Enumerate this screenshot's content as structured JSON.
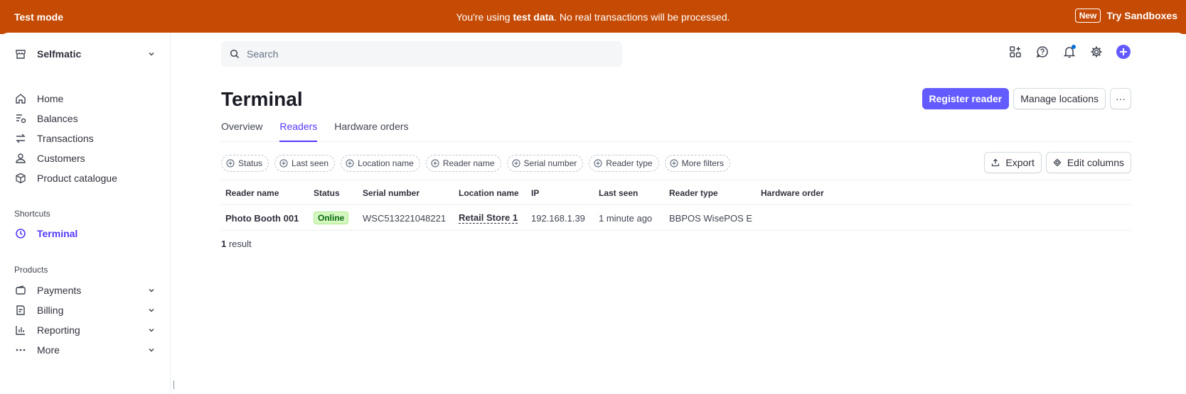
{
  "banner": {
    "left": "Test mode",
    "message_prefix": "You're using ",
    "message_bold": "test data",
    "message_suffix": ". No real transactions will be processed.",
    "badge": "New",
    "link": "Try Sandboxes"
  },
  "sidebar": {
    "account": "Selfmatic",
    "items": [
      {
        "label": "Home",
        "icon": "home-icon"
      },
      {
        "label": "Balances",
        "icon": "balances-icon"
      },
      {
        "label": "Transactions",
        "icon": "transactions-icon"
      },
      {
        "label": "Customers",
        "icon": "customers-icon"
      },
      {
        "label": "Product catalogue",
        "icon": "product-catalogue-icon"
      }
    ],
    "shortcuts_label": "Shortcuts",
    "shortcuts": [
      {
        "label": "Terminal",
        "icon": "clock-icon"
      }
    ],
    "products_label": "Products",
    "products": [
      {
        "label": "Payments",
        "icon": "wallet-icon"
      },
      {
        "label": "Billing",
        "icon": "billing-icon"
      },
      {
        "label": "Reporting",
        "icon": "reporting-icon"
      },
      {
        "label": "More",
        "icon": "more-dots-icon"
      }
    ]
  },
  "search": {
    "placeholder": "Search"
  },
  "page": {
    "title": "Terminal",
    "register_button": "Register reader",
    "manage_button": "Manage locations",
    "more_button": "···"
  },
  "tabs": [
    "Overview",
    "Readers",
    "Hardware orders"
  ],
  "active_tab": "Readers",
  "filters": [
    "Status",
    "Last seen",
    "Location name",
    "Reader name",
    "Serial number",
    "Reader type",
    "More filters"
  ],
  "table_actions": {
    "export": "Export",
    "edit_columns": "Edit columns"
  },
  "table": {
    "columns": [
      "Reader name",
      "Status",
      "Serial number",
      "Location name",
      "IP",
      "Last seen",
      "Reader type",
      "Hardware order"
    ],
    "rows": [
      {
        "reader_name": "Photo Booth 001",
        "status": "Online",
        "serial_number": "WSC513221048221",
        "location_name": "Retail Store 1",
        "ip": "192.168.1.39",
        "last_seen": "1 minute ago",
        "reader_type": "BBPOS WisePOS E",
        "hardware_order": ""
      }
    ]
  },
  "result": {
    "count": "1",
    "label": " result"
  },
  "colors": {
    "banner": "#c54b05",
    "accent": "#635bff",
    "active_nav": "#533afd",
    "online_badge_bg": "#d7f7c2"
  }
}
